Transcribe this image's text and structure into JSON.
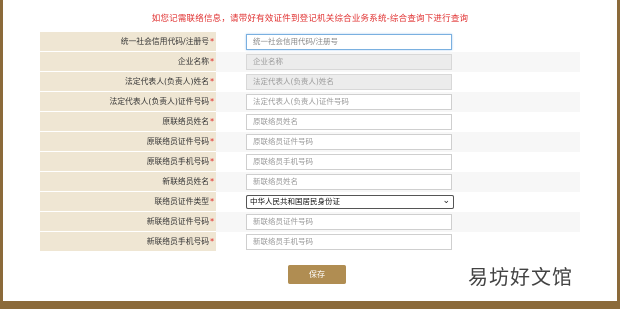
{
  "notice": "如您记需联络信息，请带好有效证件到登记机关综合业务系统-综合查询下进行查询",
  "rows": [
    {
      "label": "统一社会信用代码/注册号",
      "placeholder": "统一社会信用代码/注册号",
      "state": "focused"
    },
    {
      "label": "企业名称",
      "placeholder": "企业名称",
      "state": "disabled"
    },
    {
      "label": "法定代表人(负责人)姓名",
      "placeholder": "法定代表人(负责人)姓名",
      "state": "disabled"
    },
    {
      "label": "法定代表人(负责人)证件号码",
      "placeholder": "法定代表人(负责人)证件号码",
      "state": "normal"
    },
    {
      "label": "原联络员姓名",
      "placeholder": "原联络员姓名",
      "state": "normal"
    },
    {
      "label": "原联络员证件号码",
      "placeholder": "原联络员证件号码",
      "state": "normal"
    },
    {
      "label": "原联络员手机号码",
      "placeholder": "原联络员手机号码",
      "state": "normal"
    },
    {
      "label": "新联络员姓名",
      "placeholder": "新联络员姓名",
      "state": "normal"
    },
    {
      "label": "联络员证件类型",
      "value": "中华人民共和国居民身份证",
      "state": "select"
    },
    {
      "label": "新联络员证件号码",
      "placeholder": "新联络员证件号码",
      "state": "normal"
    },
    {
      "label": "新联络员手机号码",
      "placeholder": "新联络员手机号码",
      "state": "normal"
    }
  ],
  "required_mark": "*",
  "save_label": "保存",
  "watermark": "易坊好文馆"
}
